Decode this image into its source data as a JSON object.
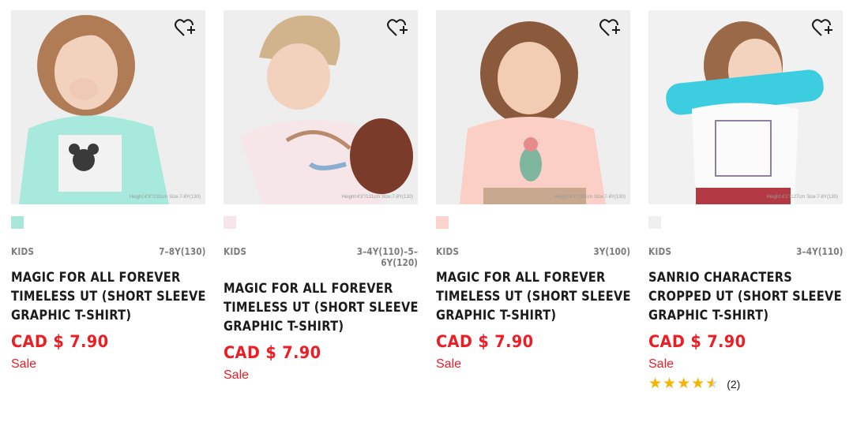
{
  "products": [
    {
      "gender": "KIDS",
      "sizes": "7–8Y(130)",
      "name": "MAGIC FOR ALL FOREVER TIMELESS UT (SHORT SLEEVE GRAPHIC T-SHIRT)",
      "price": "CAD $ 7.90",
      "flag": "Sale",
      "swatch_color": "#a9e6dd",
      "photo_note": "Height:4'3\"/131cm Size:7-8Y(130)"
    },
    {
      "gender": "KIDS",
      "sizes": "3–4Y(110)–5–6Y(120)",
      "name": "MAGIC FOR ALL FOREVER TIMELESS UT (SHORT SLEEVE GRAPHIC T-SHIRT)",
      "price": "CAD $ 7.90",
      "flag": "Sale",
      "swatch_color": "#f6e6ea",
      "photo_note": "Height:4'3\"/131cm Size:7-8Y(130)"
    },
    {
      "gender": "KIDS",
      "sizes": "3Y(100)",
      "name": "MAGIC FOR ALL FOREVER TIMELESS UT (SHORT SLEEVE GRAPHIC T-SHIRT)",
      "price": "CAD $ 7.90",
      "flag": "Sale",
      "swatch_color": "#fcd3cd",
      "photo_note": "Height:4'4\"/131cm Size:7-8Y(130)"
    },
    {
      "gender": "KIDS",
      "sizes": "3–4Y(110)",
      "name": "SANRIO CHARACTERS CROPPED UT (SHORT SLEEVE GRAPHIC T-SHIRT)",
      "price": "CAD $ 7.90",
      "flag": "Sale",
      "swatch_color": "#efefef",
      "photo_note": "Height:4'2\"/127cm Size:7-8Y(130)",
      "rating_value": 4.5,
      "review_count": "(2)"
    }
  ],
  "icons": {
    "favorite": "heart-plus-icon",
    "star": "star-icon"
  },
  "colors": {
    "price": "#ed1d24",
    "flag": "#ed1d24",
    "star": "#f5b400",
    "meta": "#7d7d7d"
  }
}
